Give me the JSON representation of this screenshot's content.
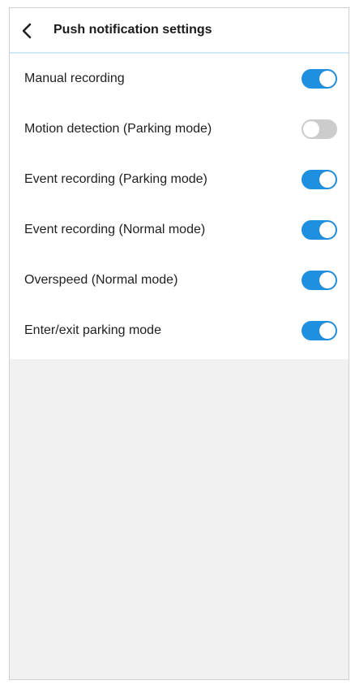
{
  "header": {
    "title": "Push notification settings",
    "back_icon": "chevron-left-icon"
  },
  "settings": [
    {
      "label": "Manual recording",
      "enabled": true
    },
    {
      "label": "Motion detection (Parking mode)",
      "enabled": false
    },
    {
      "label": "Event recording (Parking mode)",
      "enabled": true
    },
    {
      "label": "Event recording (Normal mode)",
      "enabled": true
    },
    {
      "label": "Overspeed (Normal mode)",
      "enabled": true
    },
    {
      "label": "Enter/exit parking mode",
      "enabled": true
    }
  ],
  "colors": {
    "toggle_on": "#1f8fe0",
    "toggle_off": "#cccccc",
    "header_divider": "#cfe9f5",
    "background": "#f1f1f1"
  }
}
